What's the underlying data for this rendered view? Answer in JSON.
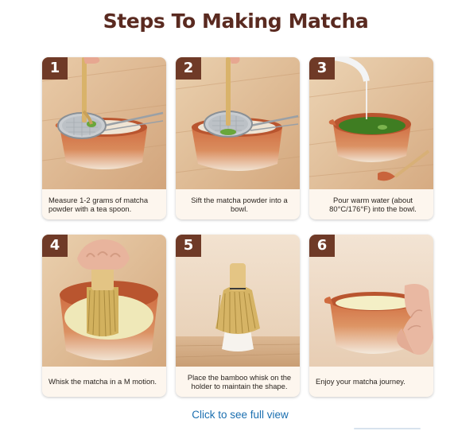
{
  "page": {
    "title": "Steps To Making Matcha",
    "link": "Click to see full view"
  },
  "steps": [
    {
      "number": "1",
      "caption": "Measure 1-2 grams of matcha powder with a tea spoon."
    },
    {
      "number": "2",
      "caption": "Sift the matcha powder into a bowl."
    },
    {
      "number": "3",
      "caption": "Pour warm water (about 80°C/176°F) into the bowl."
    },
    {
      "number": "4",
      "caption": "Whisk the matcha in a M motion."
    },
    {
      "number": "5",
      "caption": "Place the bamboo whisk on the holder to maintain the shape."
    },
    {
      "number": "6",
      "caption": "Enjoy your matcha journey."
    }
  ],
  "colors": {
    "title": "#5a2a20",
    "badge": "#6f3a27",
    "link": "#1b6fb0",
    "bowl_orange": "#c9643c",
    "matcha_green": "#4b8a2a"
  }
}
